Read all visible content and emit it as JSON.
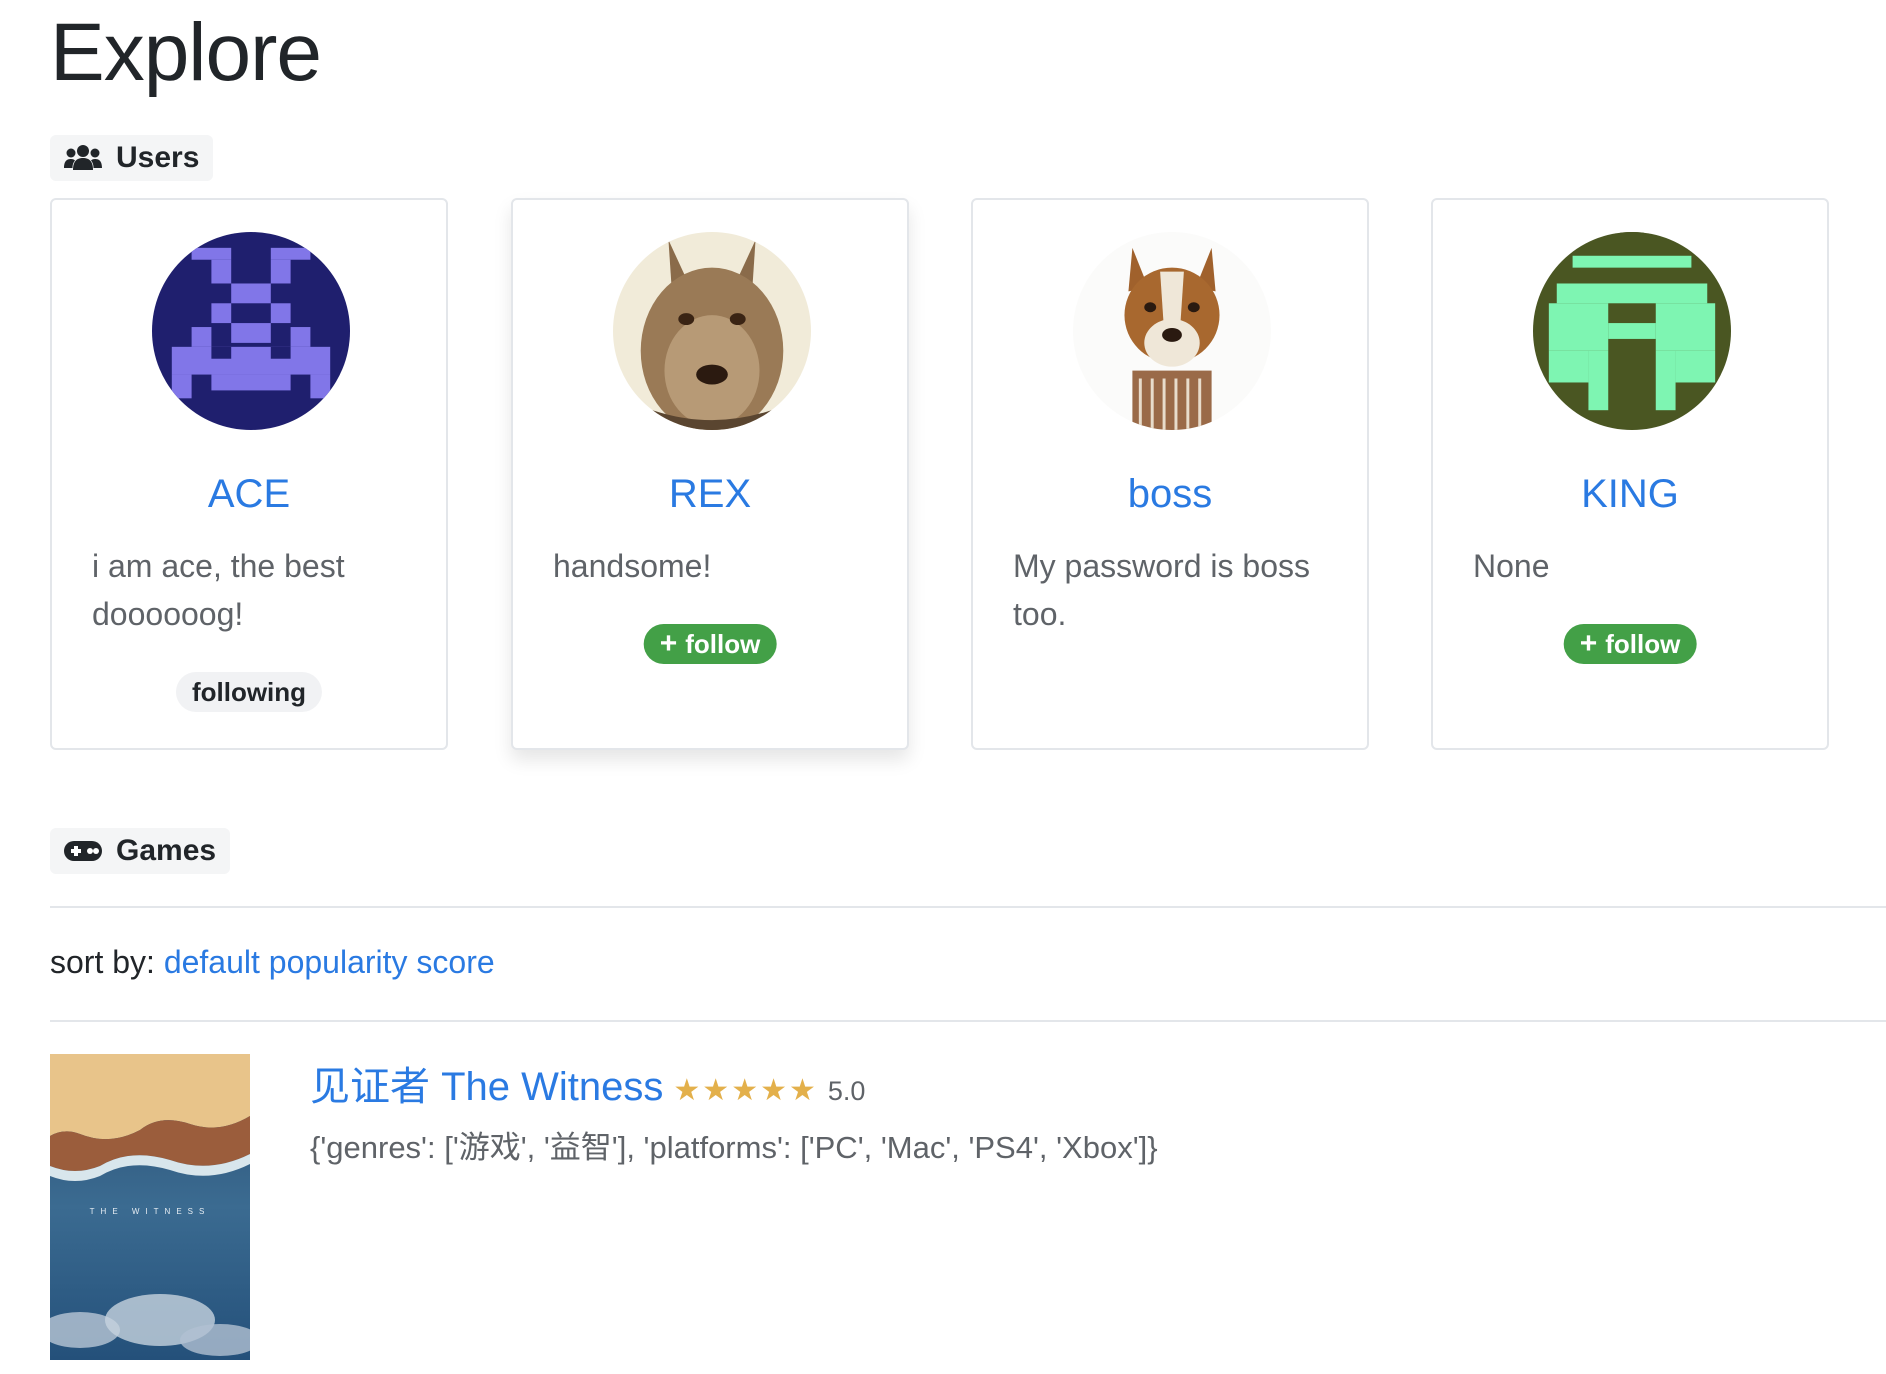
{
  "page": {
    "title": "Explore"
  },
  "users_section": {
    "label": "Users",
    "icon": "users-icon",
    "users": [
      {
        "name": "ACE",
        "bio": "i am ace, the best doooooog!",
        "status": "following",
        "avatar": "pixel-invader-avatar"
      },
      {
        "name": "REX",
        "bio": "handsome!",
        "action": "follow",
        "avatar": "dog-photo-avatar"
      },
      {
        "name": "boss",
        "bio": "My password is boss too.",
        "avatar": "dog-photo-avatar"
      },
      {
        "name": "KING",
        "bio": "None",
        "action": "follow",
        "avatar": "pixel-identicon-avatar"
      }
    ]
  },
  "games_section": {
    "label": "Games",
    "icon": "gamepad-icon",
    "sort": {
      "label": "sort by:",
      "link": "default popularity score"
    },
    "games": [
      {
        "title": "见证者 The Witness",
        "stars": "★★★★★",
        "rating": 5.0,
        "rating_text": "5.0",
        "meta": "{'genres': ['游戏', '益智'], 'platforms': ['PC', 'Mac', 'PS4', 'Xbox']}",
        "cover_text": "THE   WITNESS"
      }
    ]
  },
  "colors": {
    "link": "#2a7ae2",
    "follow_button": "#43a047",
    "star": "#e3b04b",
    "ace_avatar_bg": "#1f1f6e",
    "ace_avatar_fg": "#8176e8",
    "king_avatar_bg": "#4a5622",
    "king_avatar_fg": "#7ef5b2"
  }
}
